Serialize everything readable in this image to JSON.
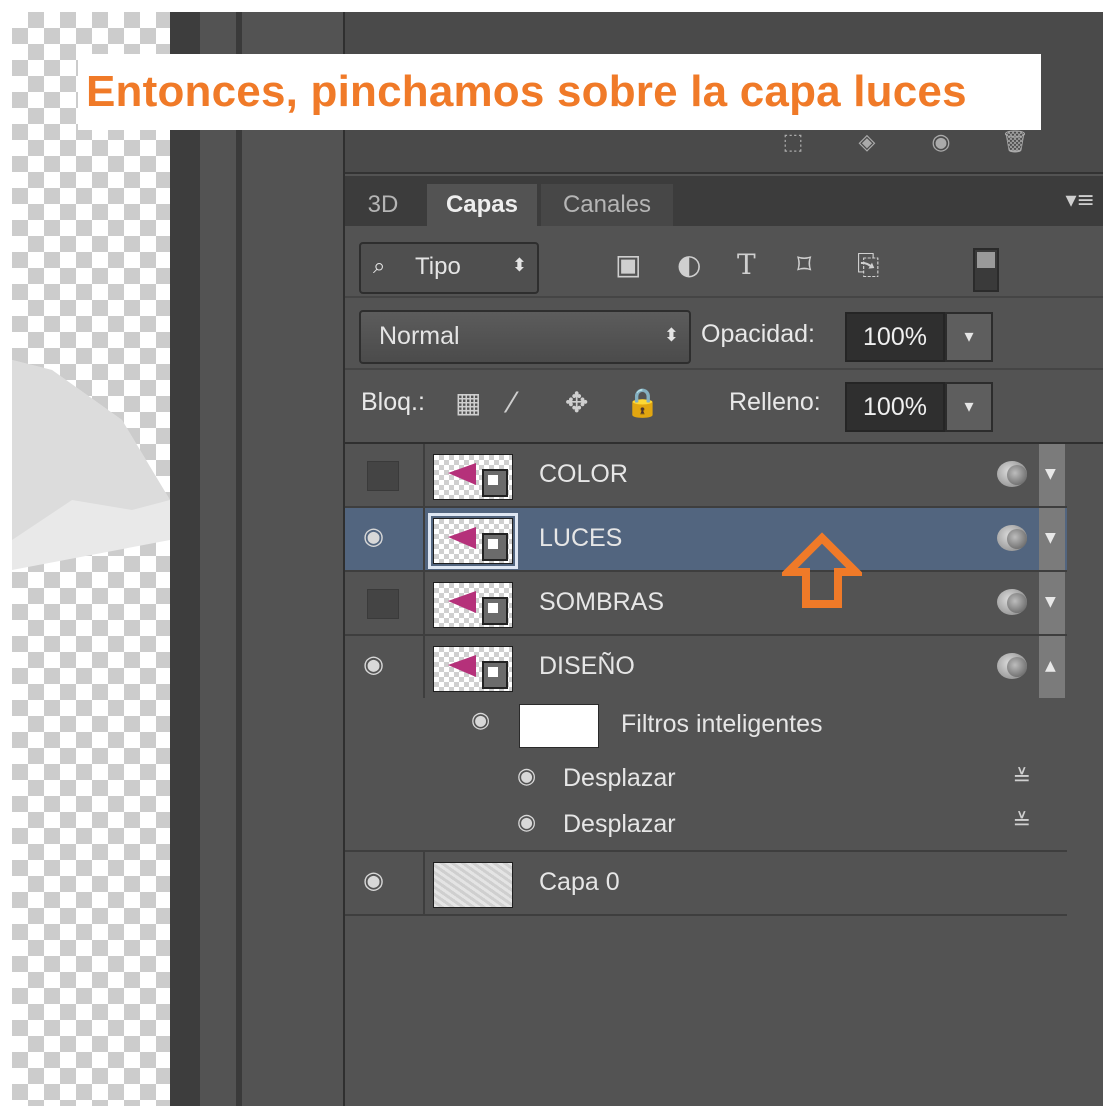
{
  "callout": {
    "text": "Entonces, pinchamos sobre la capa luces",
    "color": "#f07a28"
  },
  "panel_top_icons": [
    "selection-icon",
    "mask-icon",
    "eye-icon",
    "trash-icon"
  ],
  "tabs": [
    {
      "label": "3D",
      "active": false
    },
    {
      "label": "Capas",
      "active": true
    },
    {
      "label": "Canales",
      "active": false
    }
  ],
  "filter": {
    "kind_label": "Tipo",
    "icons": [
      "image-icon",
      "adjustment-icon",
      "text-icon",
      "shape-icon",
      "smart-object-icon"
    ]
  },
  "blend": {
    "mode": "Normal",
    "opacity_label": "Opacidad:",
    "opacity_value": "100%"
  },
  "lock": {
    "label": "Bloq.:",
    "fill_label": "Relleno:",
    "fill_value": "100%"
  },
  "layers": [
    {
      "name": "COLOR",
      "visible": false,
      "selected": false
    },
    {
      "name": "LUCES",
      "visible": true,
      "selected": true
    },
    {
      "name": "SOMBRAS",
      "visible": false,
      "selected": false
    },
    {
      "name": "DISEÑO",
      "visible": true,
      "selected": false
    }
  ],
  "smart_filters": {
    "label": "Filtros inteligentes",
    "items": [
      "Desplazar",
      "Desplazar"
    ]
  },
  "base_layer": {
    "name": "Capa 0",
    "visible": true
  },
  "selection_color": "#52657f"
}
